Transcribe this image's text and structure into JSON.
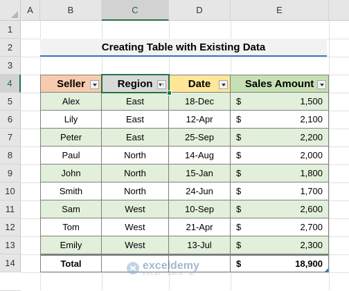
{
  "columns": [
    "A",
    "B",
    "C",
    "D",
    "E"
  ],
  "rows": [
    "1",
    "2",
    "3",
    "4",
    "5",
    "6",
    "7",
    "8",
    "9",
    "10",
    "11",
    "12",
    "13",
    "14"
  ],
  "title": "Creating Table with Existing Data",
  "table": {
    "headers": [
      "Seller",
      "Region",
      "Date",
      "Sales Amount"
    ],
    "header_colors": [
      "#f8cbad",
      "#d9d9d9",
      "#ffe699",
      "#c6e0b4"
    ],
    "band_color": "#e2efda",
    "rows": [
      {
        "seller": "Alex",
        "region": "East",
        "date": "18-Dec",
        "amount": "1,500"
      },
      {
        "seller": "Lily",
        "region": "East",
        "date": "12-Apr",
        "amount": "2,100"
      },
      {
        "seller": "Peter",
        "region": "East",
        "date": "25-Sep",
        "amount": "2,200"
      },
      {
        "seller": "Paul",
        "region": "North",
        "date": "14-Aug",
        "amount": "2,000"
      },
      {
        "seller": "John",
        "region": "North",
        "date": "15-Jan",
        "amount": "1,800"
      },
      {
        "seller": "Smith",
        "region": "North",
        "date": "24-Jun",
        "amount": "1,700"
      },
      {
        "seller": "Sam",
        "region": "West",
        "date": "10-Sep",
        "amount": "2,600"
      },
      {
        "seller": "Tom",
        "region": "West",
        "date": "21-Apr",
        "amount": "2,700"
      },
      {
        "seller": "Emily",
        "region": "West",
        "date": "13-Jul",
        "amount": "2,300"
      }
    ],
    "currency": "$",
    "total_label": "Total",
    "total_amount": "18,900"
  },
  "selected_column": "C",
  "selected_row": "4",
  "accent_color": "#217346",
  "watermark": {
    "name": "exceldemy",
    "tagline": "EXCEL · DATA · BI"
  }
}
